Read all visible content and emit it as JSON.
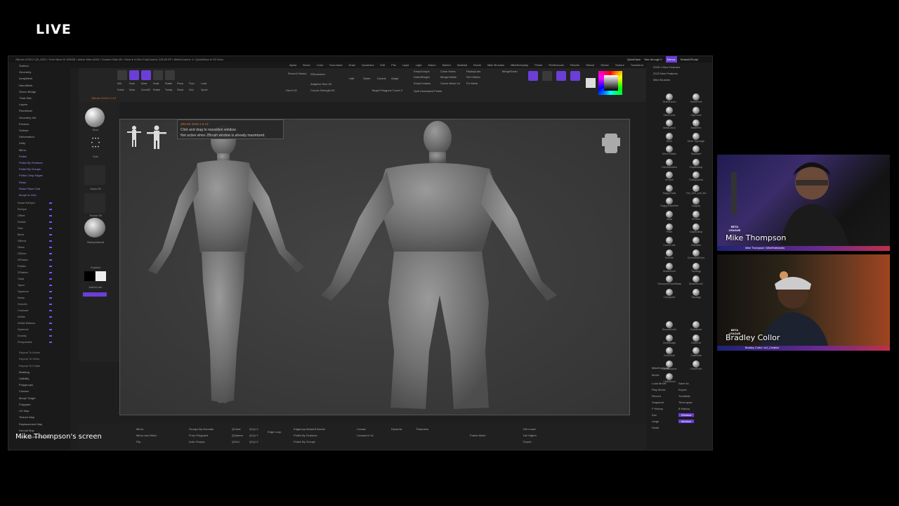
{
  "live_badge": "LIVE",
  "screen_label": "Mike Thompson's screen",
  "zbrush": {
    "title_bar": "ZBrush 2025.2   QS_0012   • Free Mem 91.928GB • Active Mem 8192 • Scratch Disk 45 • Timer ▸ 0.05 ▸ PolyCount ▸ 215.83 KP • MeshCount ▸ 4 • QuickSave In 53 Secs",
    "quick_save": "QuickSave",
    "see_through": "See-through  0",
    "menus_label": "Menus",
    "default_zscript": "DefaultZScript",
    "menu_items": [
      "Alpha",
      "Brush",
      "Color",
      "Document",
      "Draw",
      "Dynamics",
      "Edit",
      "File",
      "Layer",
      "Light",
      "Macro",
      "Marker",
      "Material",
      "Movie",
      "Mike Brushes",
      "MikeEveryday",
      "Picker",
      "Preferences",
      "Render",
      "Stencil",
      "Stroke",
      "Texture",
      "Transform",
      "Zplugin",
      "Zscript",
      "Help"
    ],
    "hint": {
      "title": "ZBrush 2025.2.0.13",
      "line1": "Click and drag to reposition window.",
      "line2": "Not active when ZBrush window is already maximized."
    },
    "doc_label": "ZBrush 2025.2.0.13",
    "left_menu": [
      "Subtool",
      "Geometry",
      "ArrayMesh",
      "NanoMesh",
      "Gizmo Bridge",
      "Thick Skin",
      "Layers",
      "FiberMesh",
      "Geometry HD",
      "Preview",
      "Surface",
      "Deformation",
      "Unify",
      "Mirror",
      "Polish",
      "Polish By Features",
      "Polish By Groups",
      "Polish Crisp Edges",
      "Relax",
      "Relax Plane Grid",
      "Morph to Grid"
    ],
    "deformation_sliders": [
      "Smart ReSym",
      "ReSym",
      "Offset",
      "Rotate",
      "Size",
      "Bend",
      "SBend",
      "Skew",
      "SSkew",
      "RFlatten",
      "Flatten",
      "SFlatten",
      "Twist",
      "Taper",
      "Squeeze",
      "Noise",
      "Smooth",
      "Contract",
      "Inflate",
      "Inflate Balloon",
      "Spherize",
      "Gravity",
      "Perspective"
    ],
    "left_bottom": [
      "Repeat To Active",
      "Repeat To Other",
      "Repeat To Folder",
      "Masking",
      "Visibility",
      "Polygroups",
      "Contact",
      "Morph Target",
      "Polypaint",
      "UV Map",
      "Texture Map",
      "Displacement Map",
      "Normal Map",
      "Vector Displacement Map"
    ],
    "shelf_labels": [
      "Move",
      "Dots",
      "Alpha Off",
      "Texture Off",
      "StartupMaterial",
      "Gradient",
      "SwitchColor",
      "Alternate"
    ],
    "toolbar_labels": [
      "Edit",
      "Draw",
      "Move",
      "Scale",
      "Rotate",
      "Persp",
      "Floor",
      "Local",
      "Frame",
      "Move",
      "Zoom3D",
      "Rotate",
      "Transp",
      "Ghost",
      "Solo",
      "Xpose"
    ],
    "toolbar_mid": [
      "Record History",
      "ZRemesher",
      "KeepGroups",
      "Close Holes",
      "ReplayLast",
      "MergeDown",
      "DetectEdges",
      "MergeVisible",
      "Del Hidden",
      "KeepCreases",
      "Check Mesh Int",
      "Fix Mesh",
      "Adaptive Size 50",
      "Curves Strength 50",
      "Target Polygons Count 5",
      "Half",
      "Same",
      "Double",
      "Adapt",
      "Dist 0.02",
      "Split Unmasked Points"
    ],
    "right_top": [
      "2025.1 New Features",
      "2023 New Features",
      "Mike Brushes"
    ],
    "brushes": [
      "SelectLasso",
      "SelectRect",
      "SliceCurve",
      "ClipCurve",
      "MaskLasso",
      "MaskPen",
      "Move",
      "Move Topologic",
      "Move Elastic",
      "Standard",
      "DamStandard",
      "ClayBuildup",
      "hPolish",
      "TrimDynamic",
      "HappyTrails",
      "The_G02_soft_fire",
      "HappyTrailsWith",
      "Magnify",
      "Inflat",
      "hPolish",
      "Pinch",
      "ClayBuildup",
      "CurveTube",
      "ZModeler",
      "Smooth",
      "CurveMultiTube",
      "SnakeHook",
      "Topology",
      "TransposeSmartMask",
      "SnakeHook2",
      "Transpose",
      "Topology",
      "SmoothCloth",
      "ClothMove",
      "ClothNudge",
      "ClothPull",
      "ClothSlide",
      "ClothHide",
      "ClothShadow",
      "ClothPinch",
      "ClothBrush"
    ],
    "right_lower": [
      "MikeEveryday",
      "Movie",
      "Load Movie",
      "Save As",
      "Play Movie",
      "Export",
      "Record",
      "Turntable",
      "Snapshot",
      "TimeLapse",
      "F History",
      "B History",
      "Doc",
      "Window",
      "Large",
      "Medium",
      "Small"
    ],
    "bottom_labels": [
      "Mirror",
      "Mirror And Weld",
      "Flip",
      "Groups By Normals",
      "From Polypaint",
      "Auto Groups",
      "QCube",
      "QSphere",
      "QGrid",
      "QCyl X",
      "QCyl Y",
      "QCyl Z",
      "Edge Loop",
      "Edgeloop Masked Border",
      "Polish By Features",
      "Polish By Groups",
      "Crease",
      "CreaseLvl 15",
      "Dynamic",
      "Thickness",
      "Frame Mesh",
      "Del Lower",
      "Del Higher",
      "Export"
    ],
    "navigator_tile": "robot-thumbnail"
  },
  "cams": [
    {
      "name": "Mike Thompson",
      "strip": "Mike Thompson / MikeRuthworks"
    },
    {
      "name": "Bradley Collor",
      "strip": "Bradley Collor / mJ_Creative"
    }
  ],
  "colors": {
    "accent": "#6b3ed8",
    "brand_gradient_start": "#1c2370",
    "brand_gradient_end": "#c12f4a"
  }
}
